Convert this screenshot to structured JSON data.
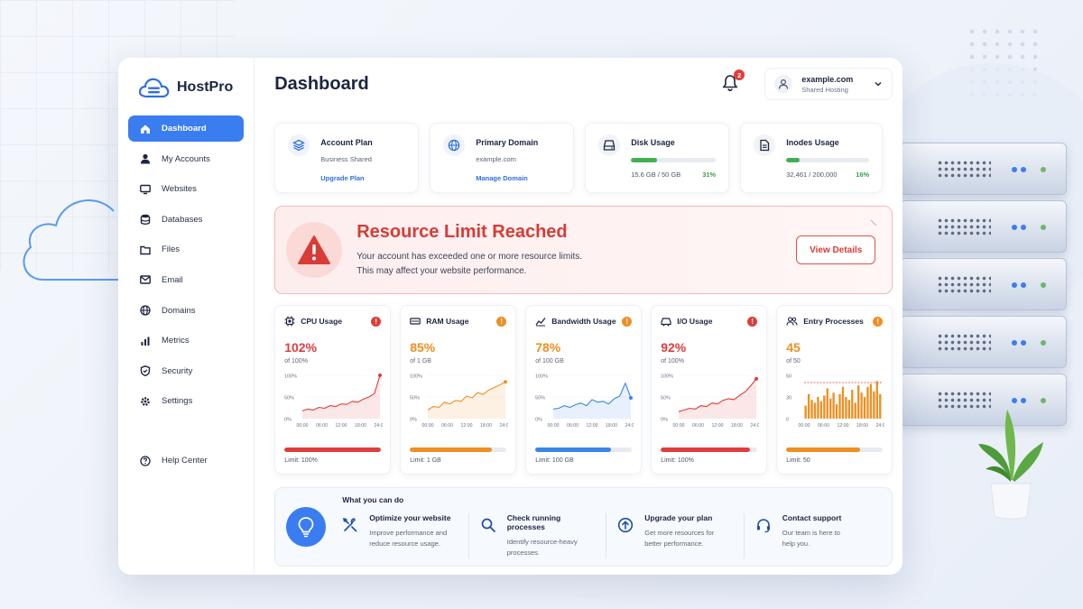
{
  "brand": {
    "name": "HostPro"
  },
  "sidebar": {
    "items": [
      {
        "label": "Dashboard",
        "icon": "home-icon",
        "active": true
      },
      {
        "label": "My Accounts",
        "icon": "user-icon"
      },
      {
        "label": "Websites",
        "icon": "monitor-icon"
      },
      {
        "label": "Databases",
        "icon": "database-icon"
      },
      {
        "label": "Files",
        "icon": "folder-icon"
      },
      {
        "label": "Email",
        "icon": "mail-icon"
      },
      {
        "label": "Domains",
        "icon": "globe-icon"
      },
      {
        "label": "Metrics",
        "icon": "bar-chart-icon"
      },
      {
        "label": "Security",
        "icon": "shield-icon"
      },
      {
        "label": "Settings",
        "icon": "gear-icon"
      }
    ],
    "help": {
      "label": "Help Center",
      "icon": "help-icon"
    }
  },
  "header": {
    "title": "Dashboard",
    "notifications": "2",
    "account": {
      "domain": "example.com",
      "plan": "Shared Hosting"
    }
  },
  "stats": {
    "plan": {
      "title": "Account Plan",
      "value": "Business Shared",
      "link": "Upgrade Plan"
    },
    "domain": {
      "title": "Primary Domain",
      "value": "example.com",
      "link": "Manage Domain"
    },
    "disk": {
      "title": "Disk Usage",
      "value": "15.6 GB / 50 GB",
      "percent": "31%",
      "fraction": 0.31
    },
    "inodes": {
      "title": "Inodes Usage",
      "value": "32,461 / 200,000",
      "percent": "16%",
      "fraction": 0.16
    }
  },
  "alert": {
    "title": "Resource Limit Reached",
    "line1": "Your account has exceeded one or more resource limits.",
    "line2": "This may affect your website performance.",
    "button": "View Details"
  },
  "metrics": [
    {
      "name": "CPU Usage",
      "value": "102%",
      "of": "of 100%",
      "limit": "Limit: 100%",
      "level": 1.0,
      "color": "#e03c3c",
      "kind": "line",
      "yticks": [
        "100%",
        "50%",
        "0%"
      ],
      "xticks": [
        "00:00",
        "06:00",
        "12:00",
        "18:00",
        "24:00"
      ],
      "series": [
        18,
        22,
        20,
        26,
        24,
        30,
        28,
        34,
        33,
        40,
        38,
        45,
        50,
        58,
        102
      ]
    },
    {
      "name": "RAM Usage",
      "value": "85%",
      "of": "of 1 GB",
      "limit": "Limit: 1 GB",
      "level": 0.85,
      "color": "#ee8f22",
      "kind": "line",
      "yticks": [
        "100%",
        "50%",
        "0%"
      ],
      "xticks": [
        "00:00",
        "06:00",
        "12:00",
        "18:00",
        "24:00"
      ],
      "series": [
        20,
        28,
        26,
        38,
        34,
        42,
        40,
        52,
        48,
        60,
        56,
        66,
        72,
        78,
        85
      ]
    },
    {
      "name": "Bandwidth Usage",
      "value": "78%",
      "of": "of 100 GB",
      "limit": "Limit: 100 GB",
      "level": 0.78,
      "color": "#3a86e6",
      "kind": "line",
      "yticks": [
        "100%",
        "50%",
        "0%"
      ],
      "xticks": [
        "00:00",
        "06:00",
        "12:00",
        "18:00",
        "24:00"
      ],
      "series": [
        22,
        24,
        30,
        26,
        32,
        36,
        30,
        44,
        38,
        40,
        34,
        46,
        52,
        82,
        48
      ]
    },
    {
      "name": "I/O Usage",
      "value": "92%",
      "of": "of 100%",
      "limit": "Limit: 100%",
      "level": 0.92,
      "color": "#e03c3c",
      "kind": "line",
      "yticks": [
        "100%",
        "50%",
        "0%"
      ],
      "xticks": [
        "00:00",
        "06:00",
        "12:00",
        "18:00",
        "24:00"
      ],
      "series": [
        16,
        20,
        24,
        22,
        30,
        28,
        36,
        34,
        42,
        46,
        44,
        54,
        62,
        76,
        92
      ]
    },
    {
      "name": "Entry Processes",
      "value": "45",
      "of": "of 50",
      "limit": "Limit: 50",
      "level": 0.76,
      "color": "#ee8f22",
      "kind": "bar",
      "yticks": [
        "50",
        "30",
        "0"
      ],
      "xticks": [
        "00:00",
        "06:00",
        "12:00",
        "18:00",
        "24:00"
      ],
      "max": 60,
      "threshold": 50,
      "series": [
        18,
        34,
        26,
        22,
        30,
        24,
        32,
        42,
        28,
        36,
        20,
        34,
        44,
        30,
        26,
        40,
        22,
        46,
        36,
        30,
        44,
        48,
        38,
        52,
        34
      ]
    }
  ],
  "tips": {
    "heading": "What you can do",
    "items": [
      {
        "title": "Optimize your website",
        "desc1": "Improve performance and",
        "desc2": "reduce resource usage.",
        "icon": "tools-icon"
      },
      {
        "title": "Check running processes",
        "desc1": "Identify resource-heavy",
        "desc2": "processes.",
        "icon": "search-icon"
      },
      {
        "title": "Upgrade your plan",
        "desc1": "Get more resources for",
        "desc2": "better performance.",
        "icon": "arrow-up-circle-icon"
      },
      {
        "title": "Contact support",
        "desc1": "Our team is here to",
        "desc2": "help you.",
        "icon": "headset-icon"
      }
    ]
  }
}
